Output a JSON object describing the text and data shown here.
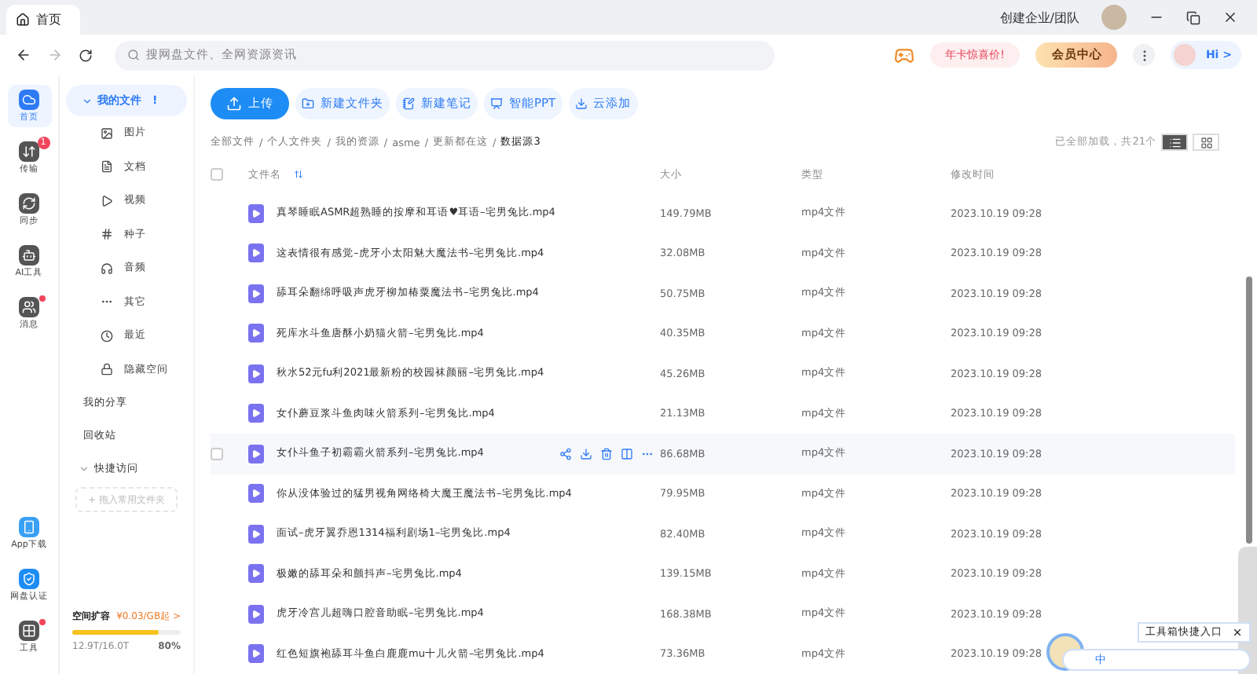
{
  "window": {
    "tab": "首页",
    "team_link": "创建企业/团队"
  },
  "toolbar": {
    "search_placeholder": "搜网盘文件、全网资源资讯",
    "promo": "年卡惊喜价!",
    "vip": "会员中心",
    "greeting": "Hi >"
  },
  "rail": {
    "top": [
      {
        "label": "首页",
        "selected": true,
        "dot": false
      },
      {
        "label": "传输",
        "selected": false,
        "count": "1",
        "dot": false
      },
      {
        "label": "同步",
        "selected": false,
        "dot": false
      },
      {
        "label": "AI工具",
        "selected": false,
        "dot": false
      },
      {
        "label": "消息",
        "selected": false,
        "dot": true
      }
    ],
    "bottom": [
      {
        "label": "App下载",
        "dot": false
      },
      {
        "label": "网盘认证",
        "dot": false
      },
      {
        "label": "工具",
        "dot": true
      }
    ]
  },
  "sidebar": {
    "my_files": {
      "label": "我的文件",
      "mark": "!",
      "expanded": true,
      "children": [
        {
          "label": "图片"
        },
        {
          "label": "文档"
        },
        {
          "label": "视频"
        },
        {
          "label": "种子"
        },
        {
          "label": "音频"
        },
        {
          "label": "其它"
        },
        {
          "label": "最近"
        },
        {
          "label": "隐藏空间"
        }
      ]
    },
    "links": [
      "我的分享",
      "回收站"
    ],
    "quick": {
      "label": "快捷访问",
      "expanded": true,
      "placeholder": "+ 拖入常用文件夹"
    },
    "storage": {
      "title": "空间扩容",
      "price": "¥0.03/GB起 >",
      "level": 0.8,
      "used": "12.9T/16.0T",
      "percent": "80%"
    }
  },
  "actions": [
    {
      "label": "上传",
      "kind": "primary"
    },
    {
      "label": "新建文件夹",
      "kind": "plain"
    },
    {
      "label": "新建笔记",
      "kind": "plain"
    },
    {
      "label": "智能PPT",
      "kind": "plain"
    },
    {
      "label": "云添加",
      "kind": "plain"
    }
  ],
  "breadcrumb_separator": "/",
  "select_all": {
    "checked": false
  },
  "breadcrumb": [
    "全部文件",
    "个人文件夹",
    "我的资源",
    "asme",
    "更新都在这",
    "数据源3"
  ],
  "load_status": "已全部加载，共21个",
  "view_modes": [
    {
      "selected": true
    },
    {
      "selected": false
    }
  ],
  "table": {
    "columns": [
      "文件名",
      "大小",
      "类型",
      "修改时间"
    ],
    "rows": [
      {
        "name": "真琴睡眠ASMR超熟睡的按摩和耳语♥耳语–宅男兔比.mp4",
        "size": "149.79MB",
        "type": "mp4文件",
        "modified": "2023.10.19 09:28",
        "hovered": false
      },
      {
        "name": "这表情很有感觉–虎牙小太阳魅大魔法书–宅男兔比.mp4",
        "size": "32.08MB",
        "type": "mp4文件",
        "modified": "2023.10.19 09:28",
        "hovered": false
      },
      {
        "name": "舔耳朵翻绵呼吸声虎牙柳加椿粟魔法书–宅男兔比.mp4",
        "size": "50.75MB",
        "type": "mp4文件",
        "modified": "2023.10.19 09:28",
        "hovered": false
      },
      {
        "name": "死库水斗鱼唐酥小奶猫火箭–宅男兔比.mp4",
        "size": "40.35MB",
        "type": "mp4文件",
        "modified": "2023.10.19 09:28",
        "hovered": false
      },
      {
        "name": "秋水52元fu利2021最新粉的校园袜颜丽–宅男兔比.mp4",
        "size": "45.26MB",
        "type": "mp4文件",
        "modified": "2023.10.19 09:28",
        "hovered": false
      },
      {
        "name": "女仆蘑豆浆斗鱼肉味火箭系列–宅男兔比.mp4",
        "size": "21.13MB",
        "type": "mp4文件",
        "modified": "2023.10.19 09:28",
        "hovered": false
      },
      {
        "name": "女仆斗鱼子初霸霸火箭系列–宅男兔比.mp4",
        "size": "86.68MB",
        "type": "mp4文件",
        "modified": "2023.10.19 09:28",
        "hovered": true
      },
      {
        "name": "你从没体验过的猛男视角网络椅大魔王魔法书–宅男兔比.mp4",
        "size": "79.95MB",
        "type": "mp4文件",
        "modified": "2023.10.19 09:28",
        "hovered": false
      },
      {
        "name": "面试–虎牙翼乔恩1314福利剧场1–宅男兔比.mp4",
        "size": "82.40MB",
        "type": "mp4文件",
        "modified": "2023.10.19 09:28",
        "hovered": false
      },
      {
        "name": "极嫩的舔耳朵和颤抖声–宅男兔比.mp4",
        "size": "139.15MB",
        "type": "mp4文件",
        "modified": "2023.10.19 09:28",
        "hovered": false
      },
      {
        "name": "虎牙冷宫儿超嗨口腔音助眠–宅男兔比.mp4",
        "size": "168.38MB",
        "type": "mp4文件",
        "modified": "2023.10.19 09:28",
        "hovered": false
      },
      {
        "name": "红色短旗袍舔耳斗鱼白鹿鹿mu十儿火箭–宅男兔比.mp4",
        "size": "73.36MB",
        "type": "mp4文件",
        "modified": "2023.10.19 09:28",
        "hovered": false
      }
    ]
  },
  "ime": {
    "tooltip": "工具箱快捷入口",
    "mode": "中"
  }
}
